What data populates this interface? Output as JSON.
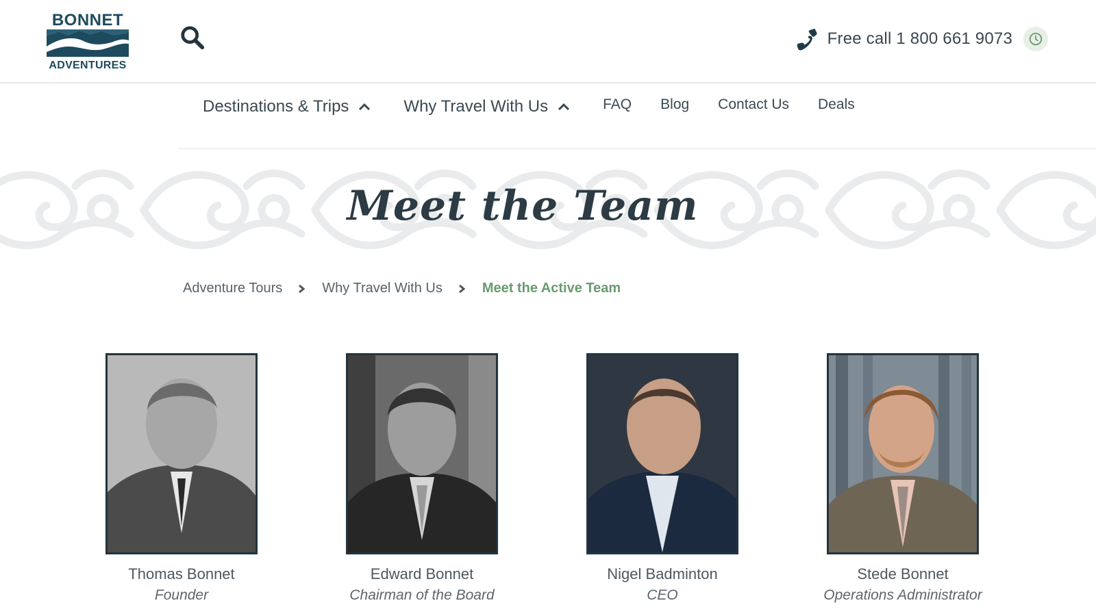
{
  "header": {
    "logo_top": "BONNET",
    "logo_bottom": "ADVENTURES",
    "phone_text": "Free call 1 800 661 9073"
  },
  "nav": {
    "items": [
      {
        "label": "Destinations & Trips",
        "icon": "chevron-up-icon"
      },
      {
        "label": "Why Travel With Us",
        "icon": "chevron-up-icon"
      },
      {
        "label": "FAQ"
      },
      {
        "label": "Blog"
      },
      {
        "label": "Contact Us"
      },
      {
        "label": "Deals"
      }
    ]
  },
  "page": {
    "title": "Meet the Team"
  },
  "breadcrumb": {
    "items": [
      "Adventure Tours",
      "Why Travel With Us"
    ],
    "current": "Meet the Active Team"
  },
  "team": [
    {
      "name": "Thomas Bonnet",
      "role": "Founder"
    },
    {
      "name": "Edward Bonnet",
      "role": "Chairman of the Board"
    },
    {
      "name": "Nigel Badminton",
      "role": "CEO"
    },
    {
      "name": "Stede Bonnet",
      "role": "Operations Administrator"
    }
  ],
  "colors": {
    "brand": "#1e4a5e",
    "text": "#3b4850",
    "accent_green": "#6a9a70",
    "photo_border": "#22343f"
  },
  "icons": [
    "search-icon",
    "phone-icon",
    "clock-icon",
    "chevron-up-icon",
    "chevron-right-icon"
  ]
}
